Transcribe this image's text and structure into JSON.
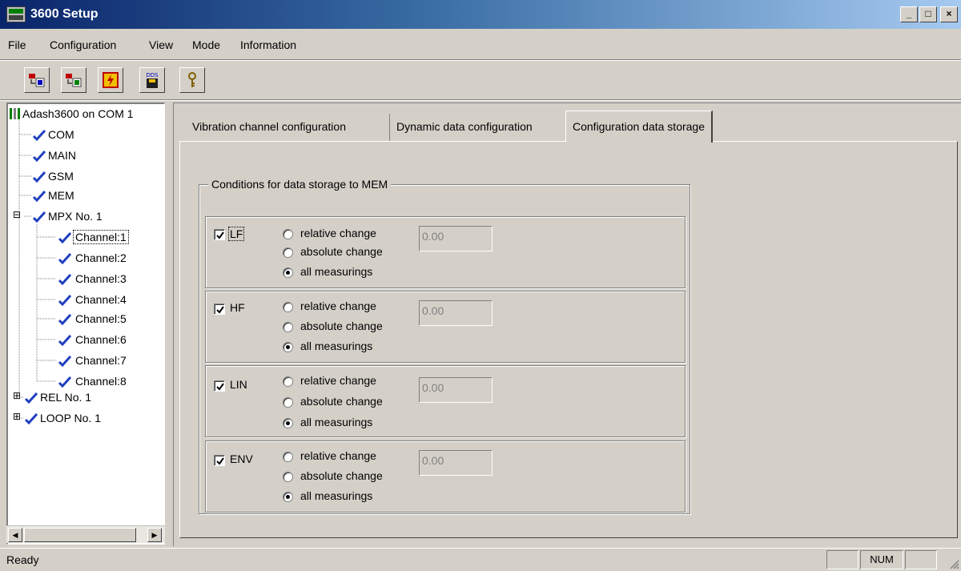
{
  "window": {
    "title": "3600 Setup",
    "controls": {
      "minimize": "_",
      "maximize": "□",
      "close": "×"
    }
  },
  "menubar": {
    "items": [
      {
        "label": "File"
      },
      {
        "label": "Configuration"
      },
      {
        "label": "View"
      },
      {
        "label": "Mode"
      },
      {
        "label": "Information"
      }
    ]
  },
  "toolbar": {
    "buttons": [
      {
        "icon": "read-config-icon"
      },
      {
        "icon": "write-config-icon"
      },
      {
        "icon": "flash-icon"
      },
      {
        "icon": "dds-icon",
        "text": "DDS"
      },
      {
        "icon": "key-icon"
      }
    ]
  },
  "tree": {
    "root": "Adash3600 on COM 1",
    "items": [
      {
        "label": "COM"
      },
      {
        "label": "MAIN"
      },
      {
        "label": "GSM"
      },
      {
        "label": "MEM"
      },
      {
        "label": "MPX No. 1",
        "expander": "⊟"
      },
      {
        "label": "Channel:1",
        "selected": true
      },
      {
        "label": "Channel:2"
      },
      {
        "label": "Channel:3"
      },
      {
        "label": "Channel:4"
      },
      {
        "label": "Channel:5"
      },
      {
        "label": "Channel:6"
      },
      {
        "label": "Channel:7"
      },
      {
        "label": "Channel:8"
      },
      {
        "label": "REL No. 1",
        "expander": "⊞"
      },
      {
        "label": "LOOP No. 1",
        "expander": "⊞"
      }
    ],
    "check_color": "#1f3fbf"
  },
  "tabs": [
    {
      "label": "Vibration channel configuration",
      "active": false
    },
    {
      "label": "Dynamic data configuration",
      "active": false
    },
    {
      "label": "Configuration data storage",
      "active": true
    }
  ],
  "storage": {
    "group_title": "Conditions for data storage to MEM",
    "radio_labels": [
      "relative change",
      "absolute change",
      "all measurings"
    ],
    "channels": [
      {
        "name": "LF",
        "checked": true,
        "selected_option": "all measurings",
        "value": "0.00",
        "focused": true
      },
      {
        "name": "HF",
        "checked": true,
        "selected_option": "all measurings",
        "value": "0.00"
      },
      {
        "name": "LIN",
        "checked": true,
        "selected_option": "all measurings",
        "value": "0.00"
      },
      {
        "name": "ENV",
        "checked": true,
        "selected_option": "all measurings",
        "value": "0.00"
      }
    ]
  },
  "statusbar": {
    "text": "Ready",
    "indicator_num": "NUM"
  }
}
